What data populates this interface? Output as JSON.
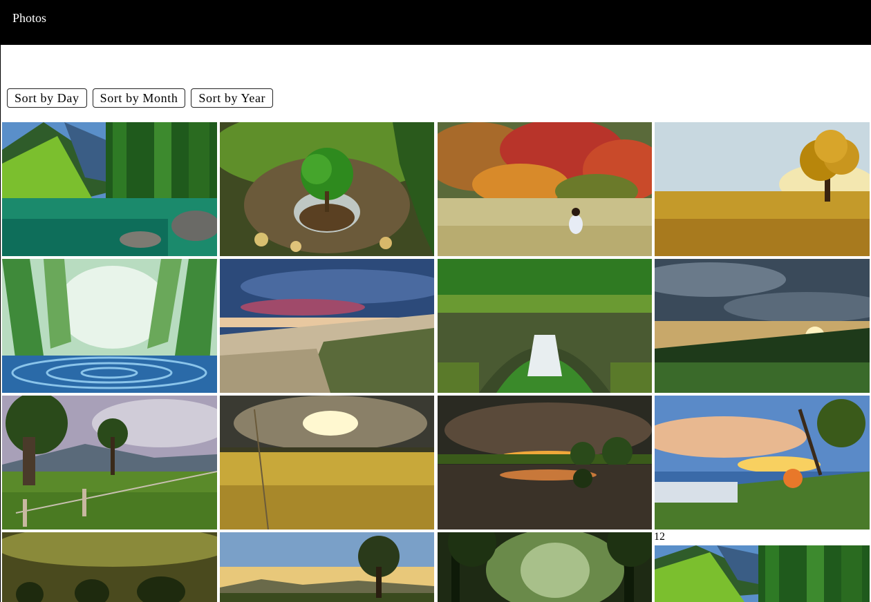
{
  "header": {
    "title": "Photos"
  },
  "sort_buttons": {
    "day": "Sort by Day",
    "month": "Sort by Month",
    "year": "Sort by Year"
  },
  "group_label": "12",
  "colors": {
    "header_bg": "#000000",
    "page_bg": "#ffffff"
  }
}
